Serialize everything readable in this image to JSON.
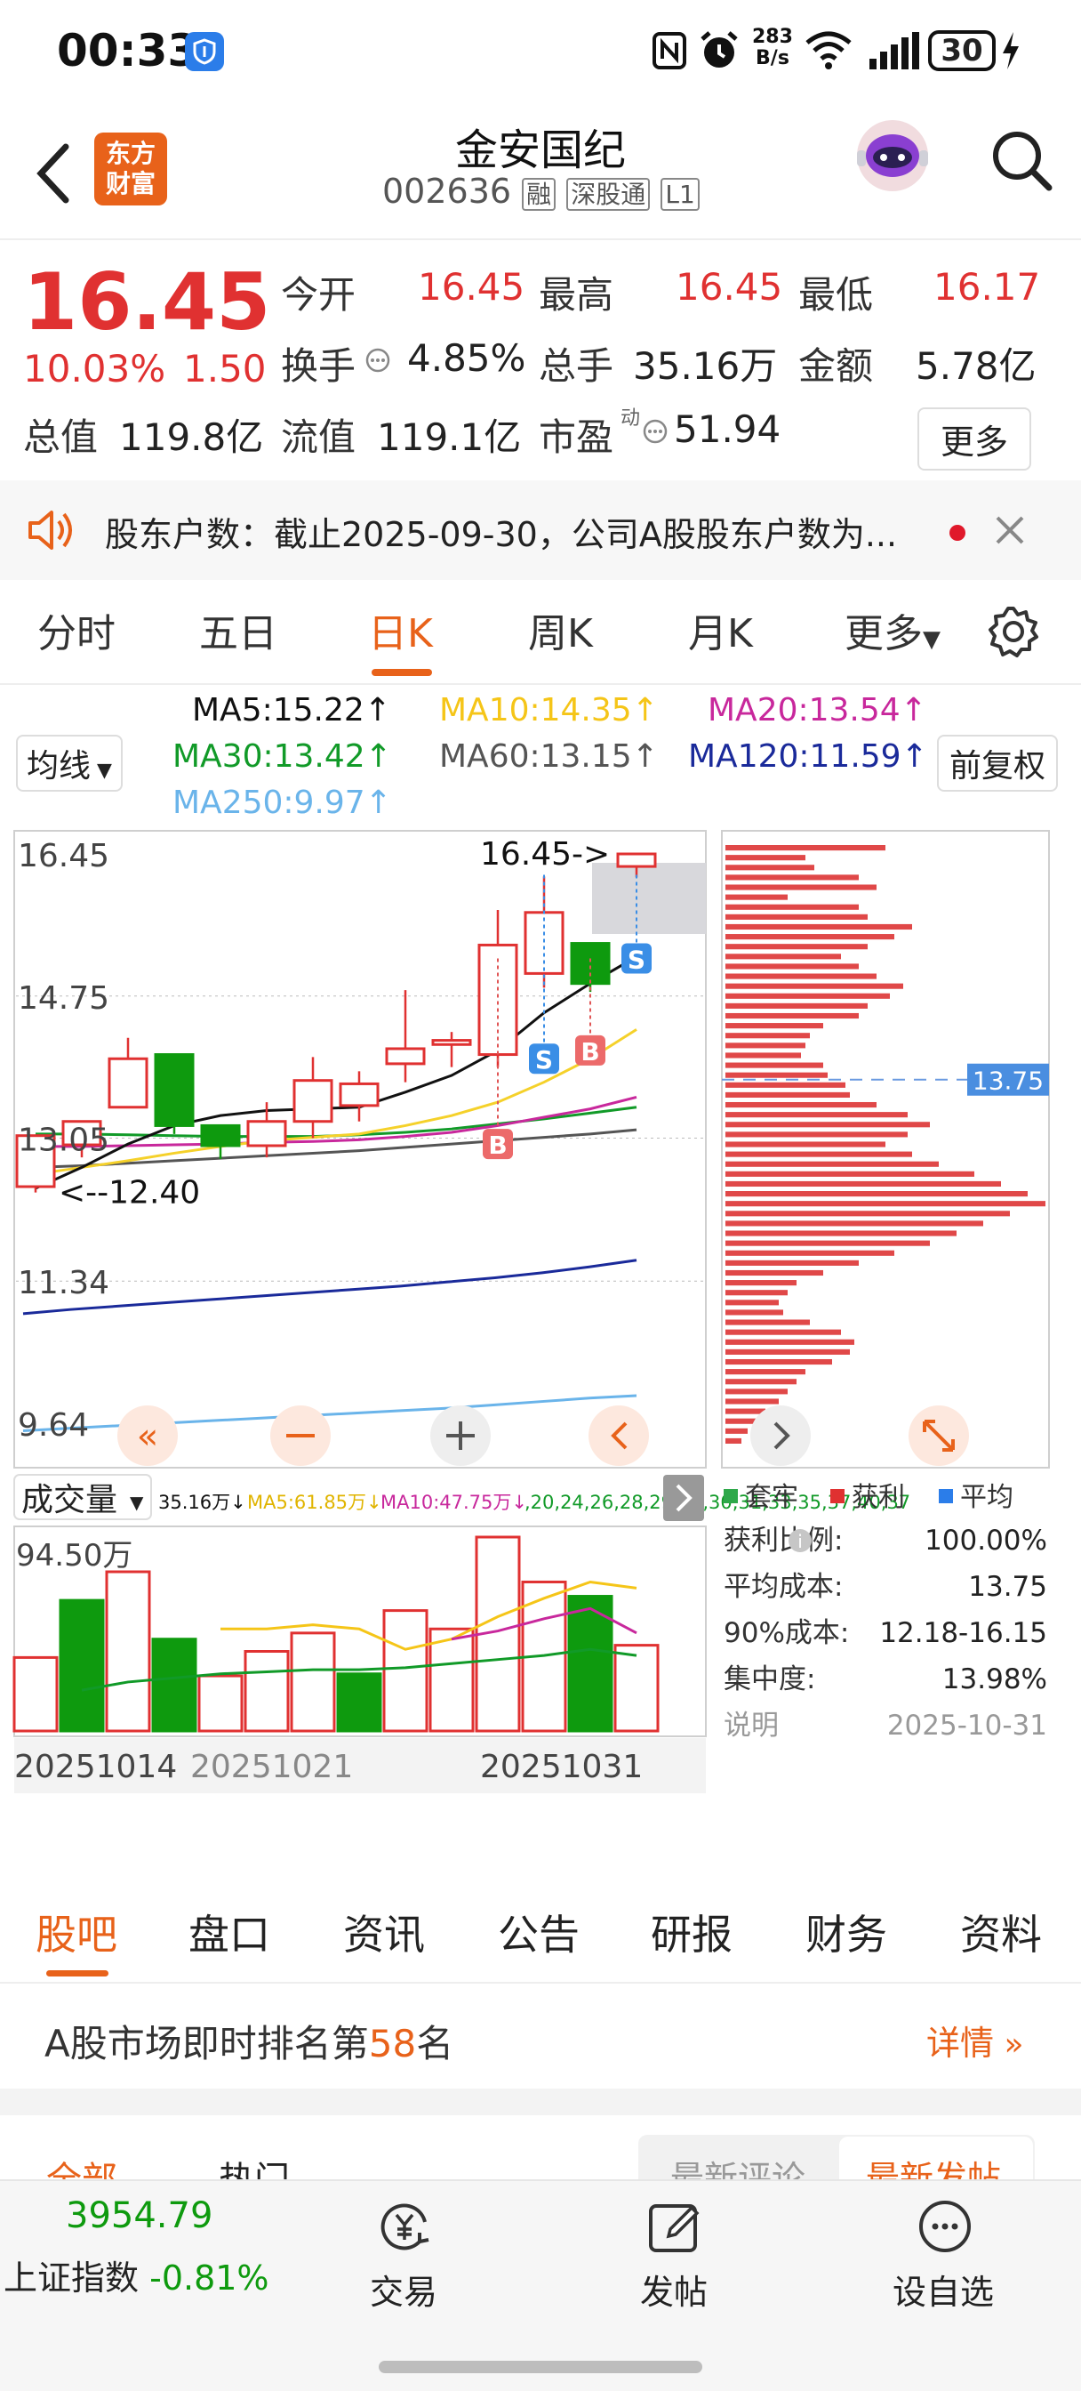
{
  "status": {
    "time": "00:33",
    "net_speed_top": "283",
    "net_speed_unit": "B/s",
    "battery": "30"
  },
  "header": {
    "logo_line1": "东方",
    "logo_line2": "财富",
    "name": "金安国纪",
    "code": "002636",
    "tag1": "融",
    "tag2": "深股通",
    "tag3": "L1"
  },
  "quote": {
    "price": "16.45",
    "change_pct": "10.03%",
    "change": "1.50",
    "open_label": "今开",
    "open": "16.45",
    "high_label": "最高",
    "high": "16.45",
    "low_label": "最低",
    "low": "16.17",
    "turnover_label": "换手",
    "turnover": "4.85%",
    "volume_label": "总手",
    "volume": "35.16万",
    "amount_label": "金额",
    "amount": "5.78亿",
    "mktcap_label": "总值",
    "mktcap": "119.8亿",
    "float_label": "流值",
    "float": "119.1亿",
    "pe_label": "市盈",
    "pe_sup": "动",
    "pe": "51.94",
    "more": "更多"
  },
  "notice": {
    "text": "股东户数：截止2025-09-30，公司A股股东户数为..."
  },
  "ktabs": {
    "t1": "分时",
    "t2": "五日",
    "t3": "日K",
    "t4": "周K",
    "t5": "月K",
    "t6": "更多"
  },
  "ma": {
    "ma5": "MA5:15.22↑",
    "ma10": "MA10:14.35↑",
    "ma20": "MA20:13.54↑",
    "ma30": "MA30:13.42↑",
    "ma60": "MA60:13.15↑",
    "ma120": "MA120:11.59↑",
    "ma250": "MA250:9.97↑",
    "selector": "均线",
    "adjust": "前复权"
  },
  "colors": {
    "up": "#e03131",
    "down": "#0e9a0e",
    "ma5": "#111111",
    "ma10": "#f5d12a",
    "ma20": "#c8289c",
    "ma30": "#119a28",
    "ma60": "#555555",
    "ma120": "#1a2a9a",
    "ma250": "#6ab4ea",
    "accent": "#e8621a"
  },
  "chart_data": {
    "type": "candlestick",
    "price_axis_labels": [
      "16.45",
      "14.75",
      "13.05",
      "11.34",
      "9.64"
    ],
    "high_marker": "16.45->",
    "low_marker": "<--12.40",
    "candles": [
      {
        "o": 12.47,
        "c": 13.08,
        "h": 13.08,
        "l": 12.4
      },
      {
        "o": 12.97,
        "c": 13.25,
        "h": 13.25,
        "l": 12.82
      },
      {
        "o": 13.42,
        "c": 14.0,
        "h": 14.25,
        "l": 13.42
      },
      {
        "o": 14.05,
        "c": 13.2,
        "h": 14.05,
        "l": 13.1
      },
      {
        "o": 13.2,
        "c": 12.96,
        "h": 13.2,
        "l": 12.8
      },
      {
        "o": 12.96,
        "c": 13.25,
        "h": 13.48,
        "l": 12.82
      },
      {
        "o": 13.25,
        "c": 13.74,
        "h": 14.02,
        "l": 13.05
      },
      {
        "o": 13.44,
        "c": 13.7,
        "h": 13.85,
        "l": 13.25
      },
      {
        "o": 13.94,
        "c": 14.12,
        "h": 14.82,
        "l": 13.72
      },
      {
        "o": 14.17,
        "c": 14.22,
        "h": 14.32,
        "l": 13.9
      },
      {
        "o": 14.05,
        "c": 15.36,
        "h": 15.78,
        "l": 13.9
      },
      {
        "o": 15.02,
        "c": 15.75,
        "h": 16.18,
        "l": 14.85
      },
      {
        "o": 15.38,
        "c": 14.9,
        "h": 15.38,
        "l": 14.8
      },
      {
        "o": 16.3,
        "c": 16.45,
        "h": 16.45,
        "l": 16.17
      }
    ],
    "ma": {
      "ma5": [
        12.45,
        12.7,
        12.98,
        13.2,
        13.32,
        13.38,
        13.4,
        13.42,
        13.6,
        13.8,
        14.1,
        14.55,
        14.9,
        15.22
      ],
      "ma10": [
        12.62,
        12.7,
        12.78,
        12.87,
        12.95,
        13.02,
        13.06,
        13.1,
        13.2,
        13.32,
        13.48,
        13.72,
        14.0,
        14.35
      ],
      "ma20": [
        12.95,
        12.95,
        12.96,
        12.97,
        12.98,
        13.0,
        13.01,
        13.03,
        13.07,
        13.12,
        13.2,
        13.3,
        13.4,
        13.54
      ],
      "ma30": [
        13.1,
        13.1,
        13.09,
        13.08,
        13.07,
        13.07,
        13.07,
        13.09,
        13.12,
        13.16,
        13.22,
        13.28,
        13.35,
        13.42
      ],
      "ma60": [
        12.7,
        12.72,
        12.75,
        12.78,
        12.81,
        12.84,
        12.87,
        12.9,
        12.94,
        12.98,
        13.02,
        13.06,
        13.1,
        13.15
      ],
      "ma120": [
        10.95,
        11.0,
        11.04,
        11.08,
        11.12,
        11.16,
        11.2,
        11.24,
        11.28,
        11.33,
        11.38,
        11.44,
        11.51,
        11.59
      ],
      "ma250": [
        9.55,
        9.58,
        9.61,
        9.64,
        9.67,
        9.7,
        9.73,
        9.76,
        9.79,
        9.82,
        9.86,
        9.9,
        9.94,
        9.97
      ]
    },
    "signals": [
      {
        "label": "B",
        "index": 10
      },
      {
        "label": "S",
        "index": 11
      },
      {
        "label": "B",
        "index": 12
      },
      {
        "label": "S",
        "index": 13
      }
    ],
    "volume": {
      "label": "成交量",
      "current": "35.16万↓",
      "ma5": "MA5:61.85万↓",
      "ma10": "MA10:47.75万↓",
      "ma20": [
        null,
        20,
        24,
        26,
        28,
        29,
        30,
        30,
        31,
        33,
        35,
        37,
        40,
        37
      ],
      "axis_top": "94.50万",
      "values": [
        36,
        64,
        78,
        45,
        27,
        39,
        48,
        28,
        59,
        50,
        95,
        73,
        66,
        42
      ],
      "up": [
        true,
        false,
        true,
        false,
        true,
        true,
        true,
        false,
        true,
        true,
        true,
        true,
        false,
        true
      ],
      "ma5_line": [
        null,
        null,
        null,
        null,
        50,
        50,
        52,
        50,
        40,
        45,
        56,
        65,
        73,
        70
      ],
      "ma10_line": [
        null,
        null,
        null,
        null,
        null,
        null,
        null,
        null,
        null,
        45,
        49,
        55,
        60,
        48
      ]
    },
    "dates": [
      "20251014",
      "20251021",
      "20251031"
    ]
  },
  "chips": {
    "price_marker": "13.75",
    "legend": {
      "trapped": "套牢",
      "profit": "获利",
      "avg": "平均"
    },
    "rows": [
      {
        "k": "获利比例:",
        "v": "100.00%"
      },
      {
        "k": "平均成本:",
        "v": "13.75"
      },
      {
        "k": "90%成本:",
        "v": "12.18-16.15"
      },
      {
        "k": "集中度:",
        "v": "13.98%"
      },
      {
        "k": "说明",
        "v": "2025-10-31"
      }
    ],
    "bars": [
      180,
      90,
      100,
      150,
      170,
      70,
      150,
      160,
      210,
      190,
      160,
      130,
      150,
      170,
      200,
      185,
      160,
      150,
      110,
      95,
      90,
      85,
      110,
      115,
      135,
      140,
      170,
      205,
      230,
      205,
      180,
      210,
      240,
      280,
      310,
      340,
      360,
      320,
      290,
      260,
      230,
      190,
      150,
      110,
      80,
      70,
      60,
      65,
      95,
      130,
      145,
      140,
      120,
      90,
      80,
      70,
      60,
      45,
      35,
      25,
      18
    ]
  },
  "tabs": {
    "t1": "股吧",
    "t2": "盘口",
    "t3": "资讯",
    "t4": "公告",
    "t5": "研报",
    "t6": "财务",
    "t7": "资料"
  },
  "rank": {
    "prefix": "A股市场即时排名第",
    "num": "58",
    "suffix": "名",
    "detail": "详情"
  },
  "partial": {
    "all": "全部",
    "hot": "热门",
    "latest_comment": "最新评论",
    "latest_post": "最新发帖"
  },
  "bottom": {
    "index_value": "3954.79",
    "index_name": "上证指数",
    "index_change": "-0.81%",
    "trade": "交易",
    "post": "发帖",
    "watch": "设自选"
  }
}
